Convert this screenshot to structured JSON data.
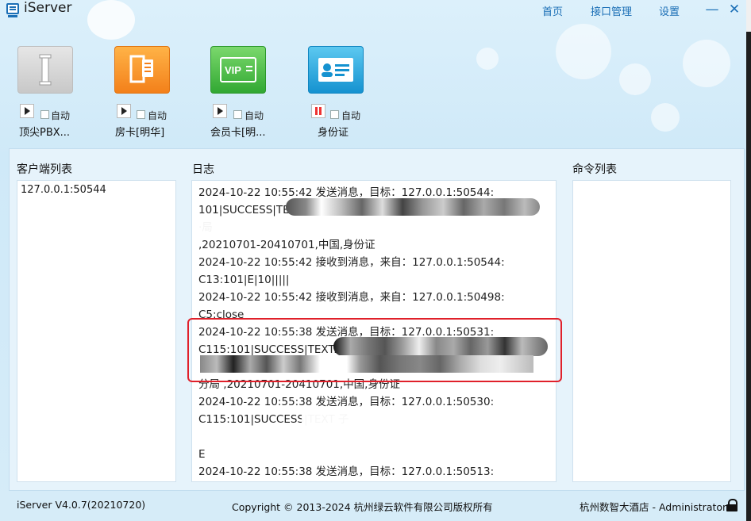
{
  "app": {
    "title": "iServer"
  },
  "topnav": [
    "首页",
    "接口管理",
    "设置"
  ],
  "window_controls": {
    "minimize": "—",
    "close": "✕"
  },
  "devices": [
    {
      "name": "顶尖PBX...",
      "auto_label": "自动",
      "state": "stopped",
      "icon": "pbx-icon",
      "colors": [
        "#d0d0d0",
        "#e4e4e4"
      ]
    },
    {
      "name": "房卡[明华]",
      "auto_label": "自动",
      "state": "stopped",
      "icon": "door-card-icon",
      "colors": [
        "#f38a1c",
        "#ffb347"
      ]
    },
    {
      "name": "会员卡[明...",
      "auto_label": "自动",
      "state": "stopped",
      "icon": "vip-card-icon",
      "colors": [
        "#3bb33b",
        "#73d36b"
      ]
    },
    {
      "name": "身份证",
      "auto_label": "自动",
      "state": "running",
      "icon": "id-card-icon",
      "colors": [
        "#1a9bd6",
        "#5cc3ee"
      ]
    }
  ],
  "panels": {
    "clients": {
      "title": "客户端列表",
      "items": [
        "127.0.0.1:50544"
      ]
    },
    "log": {
      "title": "日志",
      "lines": [
        "2024-10-22 10:55:42    发送消息，目标：127.0.0.1:50544:",
        "101|SUCCESS|TEXT:                                                           镇",
        "                                                                            ·局",
        ",20210701-20410701,中国,身份证",
        "2024-10-22 10:55:42    接收到消息，来自：127.0.0.1:50544:",
        "C13:101|E|10|||||",
        "2024-10-22 10:55:42    接收到消息，来自：127.0.0.1:50498:",
        "C5:close",
        "2024-10-22 10:55:38    发送消息，目标：127.0.0.1:50531:",
        "C115:101|SUCCESS|TEXT:",
        "",
        "分局     ,20210701-20410701,中国,身份证",
        "2024-10-22 10:55:38    发送消息，目标：127.0.0.1:50530:",
        "C115:101|SUCCESS|TEXT                                                        子",
        "",
        "                           E",
        "2024-10-22 10:55:38    发送消息，目标：127.0.0.1:50513:"
      ]
    },
    "commands": {
      "title": "命令列表",
      "items": []
    }
  },
  "status": {
    "version": "iServer V4.0.7(20210720)",
    "copyright": "Copyright © 2013-2024 杭州绿云软件有限公司版权所有",
    "user": "杭州数智大酒店 - Administrator"
  }
}
